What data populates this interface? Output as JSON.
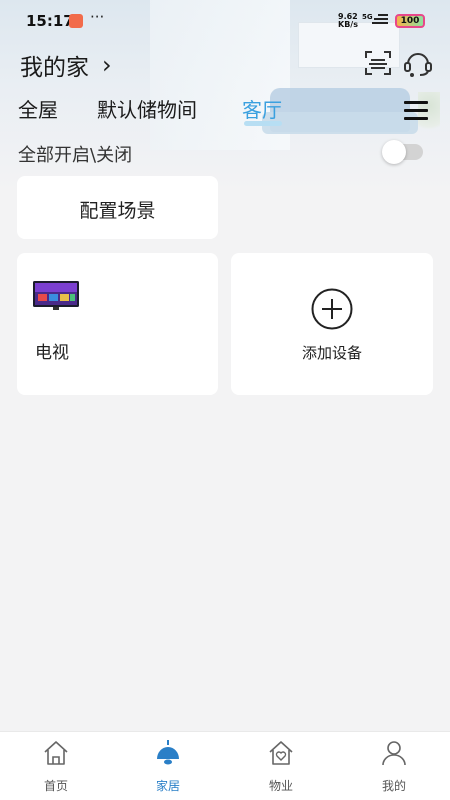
{
  "status_bar": {
    "time": "15:17",
    "more": "···",
    "net_speed_value": "9.62",
    "net_speed_unit": "KB/s",
    "network": "5G",
    "battery": "100"
  },
  "header": {
    "home_name": "我的家",
    "chevron": "›"
  },
  "tabs": [
    {
      "label": "全屋",
      "active": false
    },
    {
      "label": "默认储物间",
      "active": false
    },
    {
      "label": "客厅",
      "active": true
    }
  ],
  "toggle_all": {
    "label": "全部开启\\关闭",
    "on": false
  },
  "scene_card": {
    "label": "配置场景"
  },
  "devices": [
    {
      "name": "电视",
      "icon": "tv-icon"
    }
  ],
  "add_device": {
    "label": "添加设备",
    "icon": "plus-circle-icon"
  },
  "bottom_nav": [
    {
      "label": "首页",
      "icon": "home-icon",
      "active": false
    },
    {
      "label": "家居",
      "icon": "lamp-icon",
      "active": true
    },
    {
      "label": "物业",
      "icon": "house-heart-icon",
      "active": false
    },
    {
      "label": "我的",
      "icon": "user-icon",
      "active": false
    }
  ],
  "colors": {
    "accent": "#3aa0df",
    "nav_active": "#2a7fc7",
    "background": "#f3f3f4"
  }
}
